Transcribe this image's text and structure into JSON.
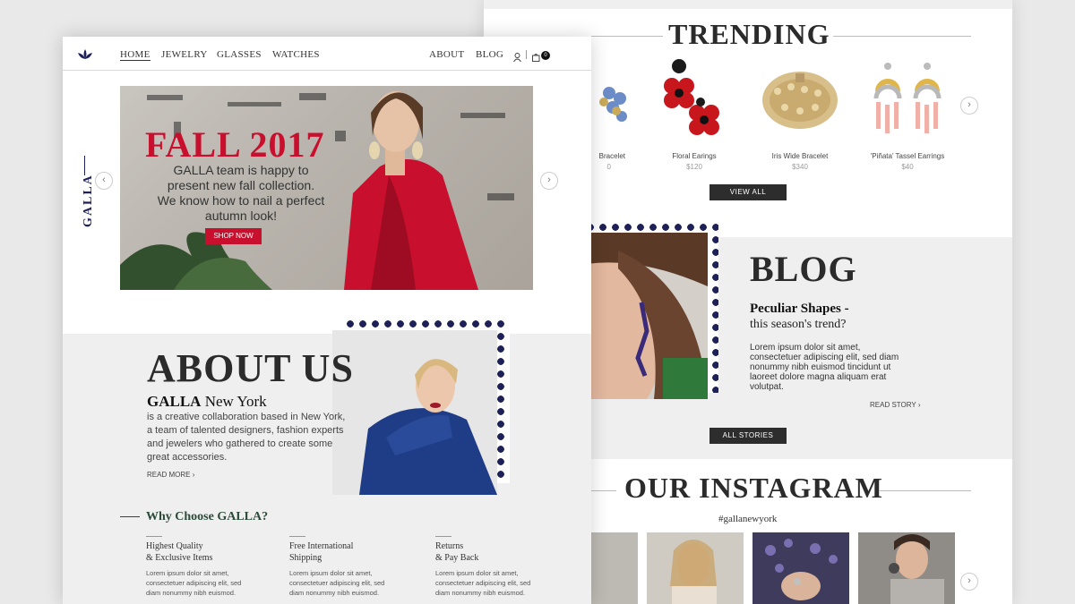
{
  "colors": {
    "accent_red": "#c8102e",
    "navy": "#1d2157",
    "dark_button": "#2d2d2d",
    "green_heading": "#2b4a3a"
  },
  "front": {
    "nav": {
      "logo_icon": "lotus-icon",
      "items": [
        "HOME",
        "JEWELRY",
        "GLASSES",
        "WATCHES"
      ],
      "right_items": [
        "ABOUT",
        "BLOG"
      ],
      "cart_count": "0"
    },
    "side_brand": "GALLA",
    "hero": {
      "title": "FALL 2017",
      "text": [
        "GALLA team is happy to",
        "present new fall collection.",
        "We know how to nail a perfect",
        "autumn look!"
      ],
      "cta": "SHOP NOW"
    },
    "about": {
      "title": "ABOUT US",
      "brand_bold": "GALLA",
      "brand_rest": " New York",
      "text": [
        "is a creative collaboration based in New York,",
        "a team of talented designers, fashion experts",
        "and jewelers who gathered to create  some",
        "great accessories."
      ],
      "read_more": "READ MORE"
    },
    "why": {
      "title": "Why Choose GALLA?",
      "columns": [
        {
          "title": [
            "Highest Quality",
            "& Exclusive Items"
          ],
          "text": [
            "Lorem ipsum dolor sit amet,",
            "consectetuer adipiscing elit, sed",
            "diam nonummy nibh euismod."
          ]
        },
        {
          "title": [
            "Free International",
            "Shipping"
          ],
          "text": [
            "Lorem ipsum dolor sit amet,",
            "consectetuer adipiscing elit, sed",
            "diam nonummy nibh euismod."
          ]
        },
        {
          "title": [
            "Returns",
            "& Pay Back"
          ],
          "text": [
            "Lorem ipsum dolor sit amet,",
            "consectetuer adipiscing elit, sed",
            "diam nonummy nibh euismod."
          ]
        }
      ]
    }
  },
  "back": {
    "trending": {
      "title": "TRENDING",
      "products": [
        {
          "name": "Bracelet",
          "price": "0"
        },
        {
          "name": "Floral Earings",
          "price": "$120"
        },
        {
          "name": "Iris Wide Bracelet",
          "price": "$340"
        },
        {
          "name": "'Piñata' Tassel Earrings",
          "price": "$40"
        }
      ],
      "view_all": "VIEW ALL"
    },
    "blog": {
      "title": "BLOG",
      "post_title": "Peculiar Shapes -",
      "post_subtitle": "this season's trend?",
      "text": [
        "Lorem ipsum dolor sit amet,",
        "consectetuer adipiscing elit, sed diam",
        "nonummy nibh euismod tincidunt ut",
        "laoreet dolore magna aliquam erat",
        "volutpat."
      ],
      "read_story": "READ STORY",
      "all_stories": "ALL STORIES"
    },
    "instagram": {
      "title": "OUR INSTAGRAM",
      "hashtag": "#gallanewyork"
    }
  }
}
